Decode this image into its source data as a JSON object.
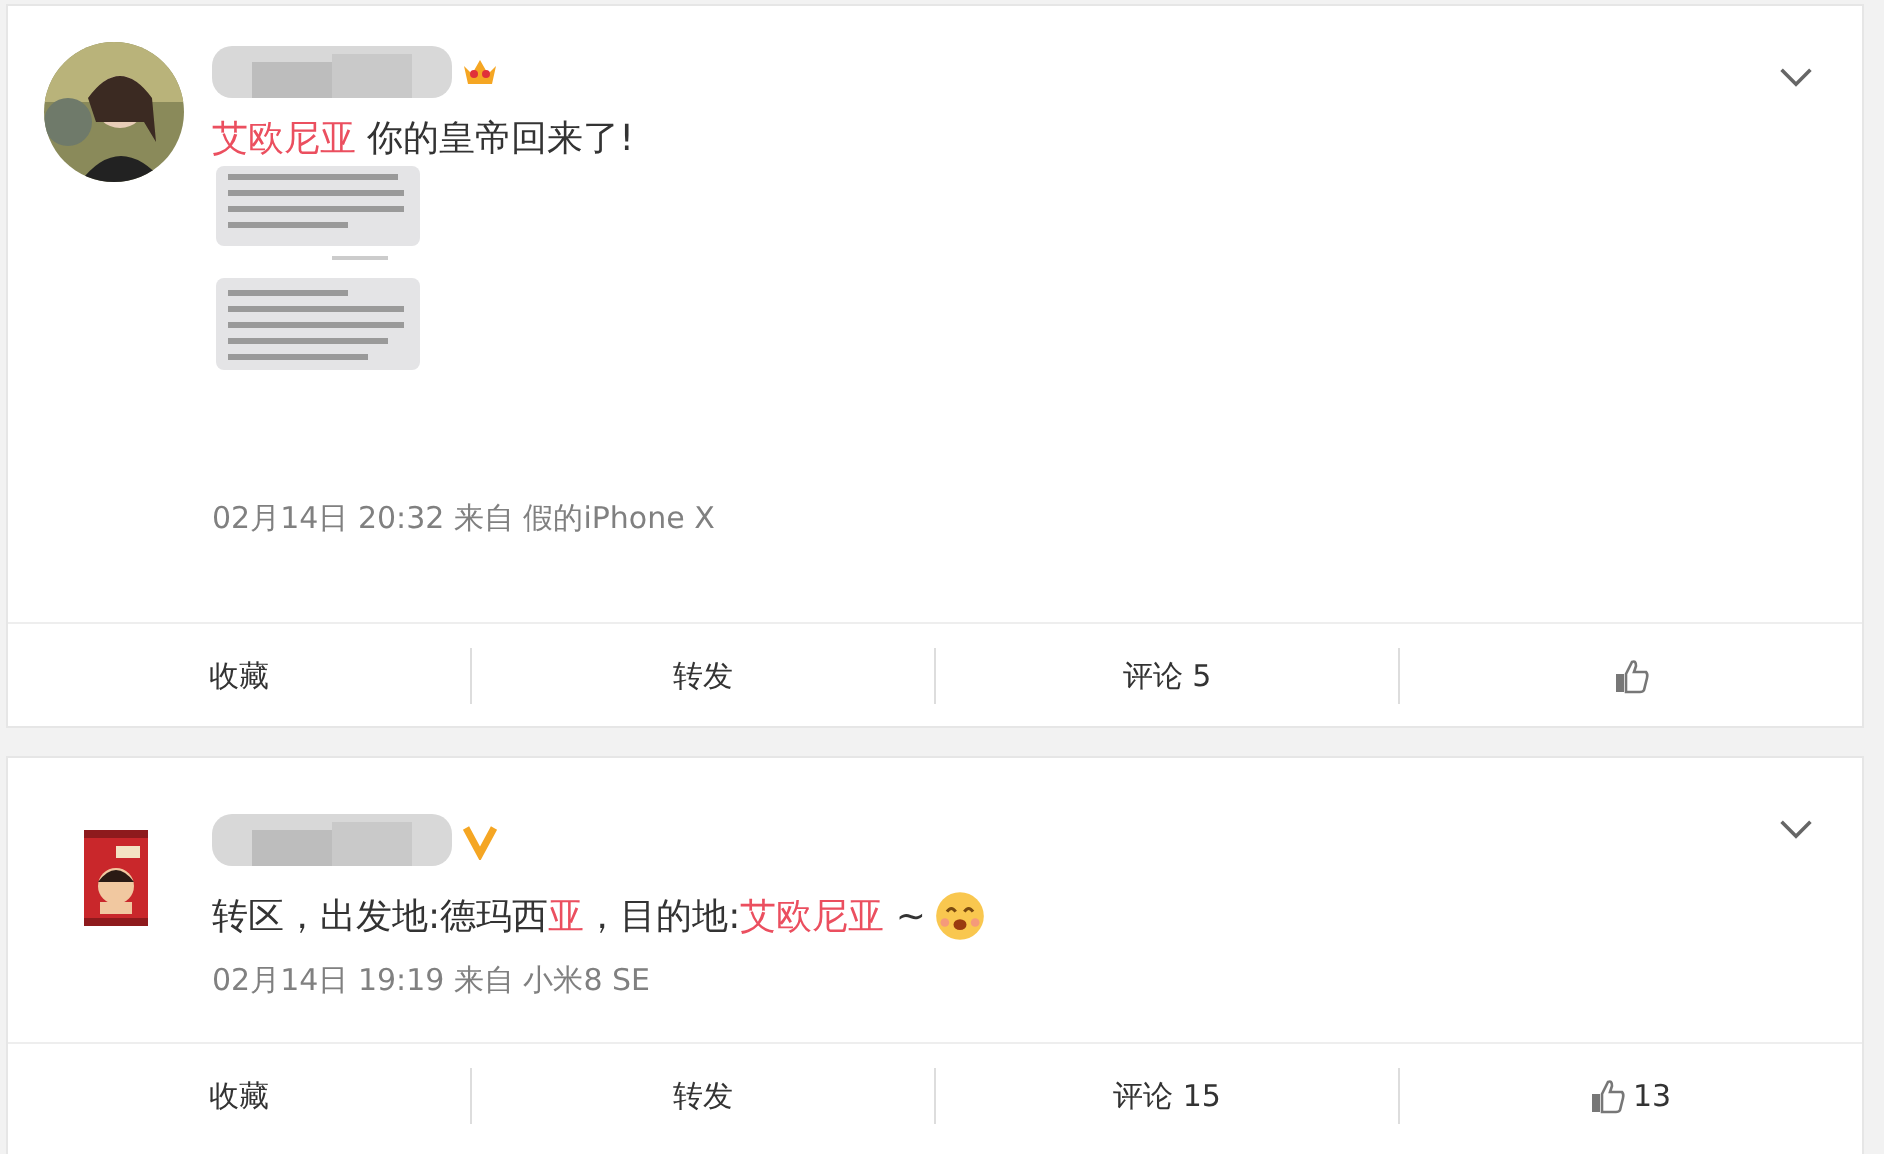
{
  "posts": [
    {
      "badge": {
        "kind": "crown"
      },
      "segments": [
        {
          "text": "艾欧尼亚",
          "highlight": true
        },
        {
          "text": " 你的皇帝回来了!",
          "highlight": false
        }
      ],
      "image": {
        "kind": "picture"
      },
      "timestamp": "02月14日 20:32 来自 假的iPhone X",
      "actions": [
        {
          "kind": "text",
          "label": "收藏"
        },
        {
          "kind": "text",
          "label": "转发"
        },
        {
          "kind": "text",
          "label": "评论 5"
        },
        {
          "kind": "like"
        }
      ]
    },
    {
      "badge": {
        "kind": "verified"
      },
      "segments": [
        {
          "text": "转区，出发地:德玛西",
          "highlight": false
        },
        {
          "text": "亚",
          "highlight": true
        },
        {
          "text": "，目的地:",
          "highlight": false
        },
        {
          "text": "艾欧尼亚",
          "highlight": true
        },
        {
          "text": " ~",
          "highlight": false
        }
      ],
      "emoji": true,
      "timestamp": "02月14日 19:19 来自 小米8 SE",
      "actions": [
        {
          "kind": "text",
          "label": "收藏"
        },
        {
          "kind": "text",
          "label": "转发"
        },
        {
          "kind": "text",
          "label": "评论 15"
        },
        {
          "kind": "like",
          "count": "13"
        }
      ]
    }
  ]
}
